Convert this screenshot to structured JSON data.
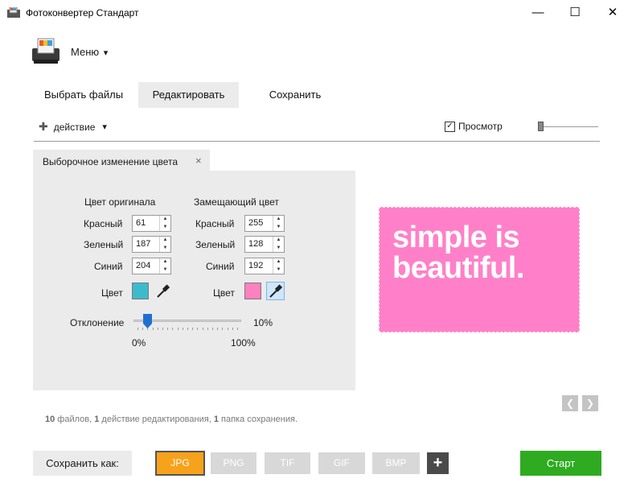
{
  "window": {
    "title": "Фотоконвертер Стандарт",
    "minimize_icon": "—",
    "maximize_icon": "☐",
    "close_icon": "✕"
  },
  "menu": {
    "label": "Меню",
    "caret": "▾"
  },
  "tabs": [
    {
      "label": "Выбрать файлы"
    },
    {
      "label": "Редактировать"
    },
    {
      "label": "Сохранить"
    }
  ],
  "toolbar": {
    "add_icon": "✚",
    "action_label": "действие",
    "caret": "▾",
    "preview_label": "Просмотр",
    "preview_checked": true,
    "zoom_level": 0.02
  },
  "panel": {
    "tab_label": "Выборочное изменение цвета",
    "close_icon": "×",
    "original": {
      "header": "Цвет оригинала",
      "red": "61",
      "green": "187",
      "blue": "204",
      "swatch": "#3dbbcc"
    },
    "replace": {
      "header": "Замещающий цвет",
      "red": "255",
      "green": "128",
      "blue": "192",
      "swatch": "#ff80c0"
    },
    "labels": {
      "red": "Красный",
      "green": "Зеленый",
      "blue": "Синий",
      "color": "Цвет"
    },
    "deviation": {
      "label": "Отклонение",
      "value": "10%",
      "fraction": 0.1,
      "min": "0%",
      "max": "100%"
    }
  },
  "preview": {
    "line1": "simple is",
    "line2": "beautiful.",
    "bg": "#ff80c8"
  },
  "nav": {
    "prev_icon": "❮",
    "next_icon": "❯"
  },
  "summary": {
    "files_count": "10",
    "files_text": " файлов, ",
    "actions_count": "1",
    "actions_text": " действие редактирования, ",
    "folders_count": "1",
    "folders_text": " папка сохранения."
  },
  "save": {
    "label": "Сохранить как:",
    "formats": [
      "JPG",
      "PNG",
      "TIF",
      "GIF",
      "BMP"
    ],
    "selected": "JPG",
    "add_icon": "+",
    "start": "Старт"
  },
  "colors": {
    "accent": "#f7a21b",
    "start": "#2eab20",
    "slider": "#1f6fd1"
  }
}
